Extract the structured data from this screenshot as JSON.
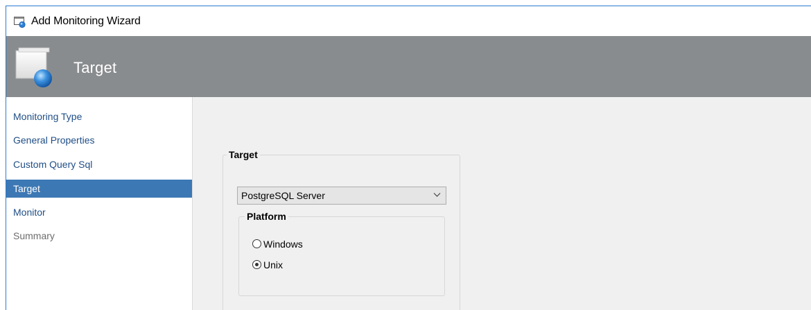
{
  "window": {
    "title": "Add Monitoring Wizard",
    "icon": "wizard-window-icon"
  },
  "banner": {
    "title": "Target",
    "icon": "wizard-page-icon",
    "background": "#898c8e"
  },
  "sidebar": {
    "items": [
      {
        "label": "Monitoring Type",
        "state": "normal"
      },
      {
        "label": "General Properties",
        "state": "normal"
      },
      {
        "label": "Custom Query Sql",
        "state": "normal"
      },
      {
        "label": "Target",
        "state": "active"
      },
      {
        "label": "Monitor",
        "state": "normal"
      },
      {
        "label": "Summary",
        "state": "disabled"
      }
    ],
    "active_color": "#3c78b4",
    "link_color": "#1f4e86"
  },
  "target_group": {
    "label": "Target",
    "select": {
      "value": "PostgreSQL Server",
      "icon": "chevron-down-icon"
    },
    "platform_group": {
      "label": "Platform",
      "options": [
        {
          "label": "Windows",
          "checked": false
        },
        {
          "label": "Unix",
          "checked": true
        }
      ]
    }
  }
}
